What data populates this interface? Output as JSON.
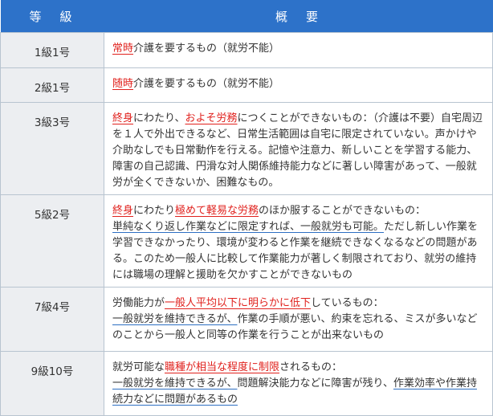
{
  "header": {
    "grade": "等　級",
    "summary": "概　要"
  },
  "rows": [
    {
      "grade": "1級1号",
      "segs": [
        {
          "t": "常時",
          "c": "red ul"
        },
        {
          "t": "介護を要するもの（就労不能）",
          "c": ""
        }
      ]
    },
    {
      "grade": "2級1号",
      "segs": [
        {
          "t": "随時",
          "c": "red ul"
        },
        {
          "t": "介護を要するもの（就労不能）",
          "c": ""
        }
      ]
    },
    {
      "grade": "3級3号",
      "segs": [
        {
          "t": "終身",
          "c": "red ul"
        },
        {
          "t": "にわたり、",
          "c": ""
        },
        {
          "t": "およそ労務",
          "c": "red ul"
        },
        {
          "t": "につくことができないもの：（介護は不要）自宅周辺を１人で外出できるなど、日常生活範囲は自宅に限定されていない。声かけや介助なしでも日常動作を行える。記憶や注意力、新しいことを学習する能力、障害の自己認識、円滑な対人関係維持能力などに著しい障害があって、一般就労が全くできないか、困難なもの。",
          "c": ""
        }
      ]
    },
    {
      "grade": "5級2号",
      "segs": [
        {
          "t": "終身",
          "c": "red ul"
        },
        {
          "t": "にわたり",
          "c": ""
        },
        {
          "t": "極めて軽易な労務",
          "c": "red ul"
        },
        {
          "t": "のほか服することができないもの：",
          "c": ""
        },
        {
          "br": true
        },
        {
          "t": "単純なくり返し作業などに限定すれば、一般就労も可能。",
          "c": "ulb"
        },
        {
          "t": "ただし新しい作業を学習できなかったり、環境が変わると作業を継続できなくなるなどの問題がある。このため一般人に比較して作業能力が著しく制限されており、就労の維持には職場の理解と援助を欠かすことができないもの",
          "c": ""
        }
      ]
    },
    {
      "grade": "7級4号",
      "segs": [
        {
          "t": "労働能力が",
          "c": ""
        },
        {
          "t": "一般人平均以下に明らかに低下",
          "c": "red ul"
        },
        {
          "t": "しているもの：",
          "c": ""
        },
        {
          "br": true
        },
        {
          "t": "一般就労を維持できるが、",
          "c": "ulb"
        },
        {
          "t": "作業の手順が悪い、約束を忘れる、ミスが多いなどのことから一般人と同等の作業を行うことが出来ないもの",
          "c": ""
        }
      ]
    },
    {
      "grade": "9級10号",
      "segs": [
        {
          "t": "就労可能な",
          "c": ""
        },
        {
          "t": "職種が相当な程度に制限",
          "c": "red ul"
        },
        {
          "t": "されるもの：",
          "c": ""
        },
        {
          "br": true
        },
        {
          "t": "一般就労を維持できるが、",
          "c": "ulb"
        },
        {
          "t": "問題解決能力などに障害が残り、",
          "c": ""
        },
        {
          "t": "作業効率や作業持続力などに問題があるもの",
          "c": "ulb"
        }
      ]
    }
  ]
}
